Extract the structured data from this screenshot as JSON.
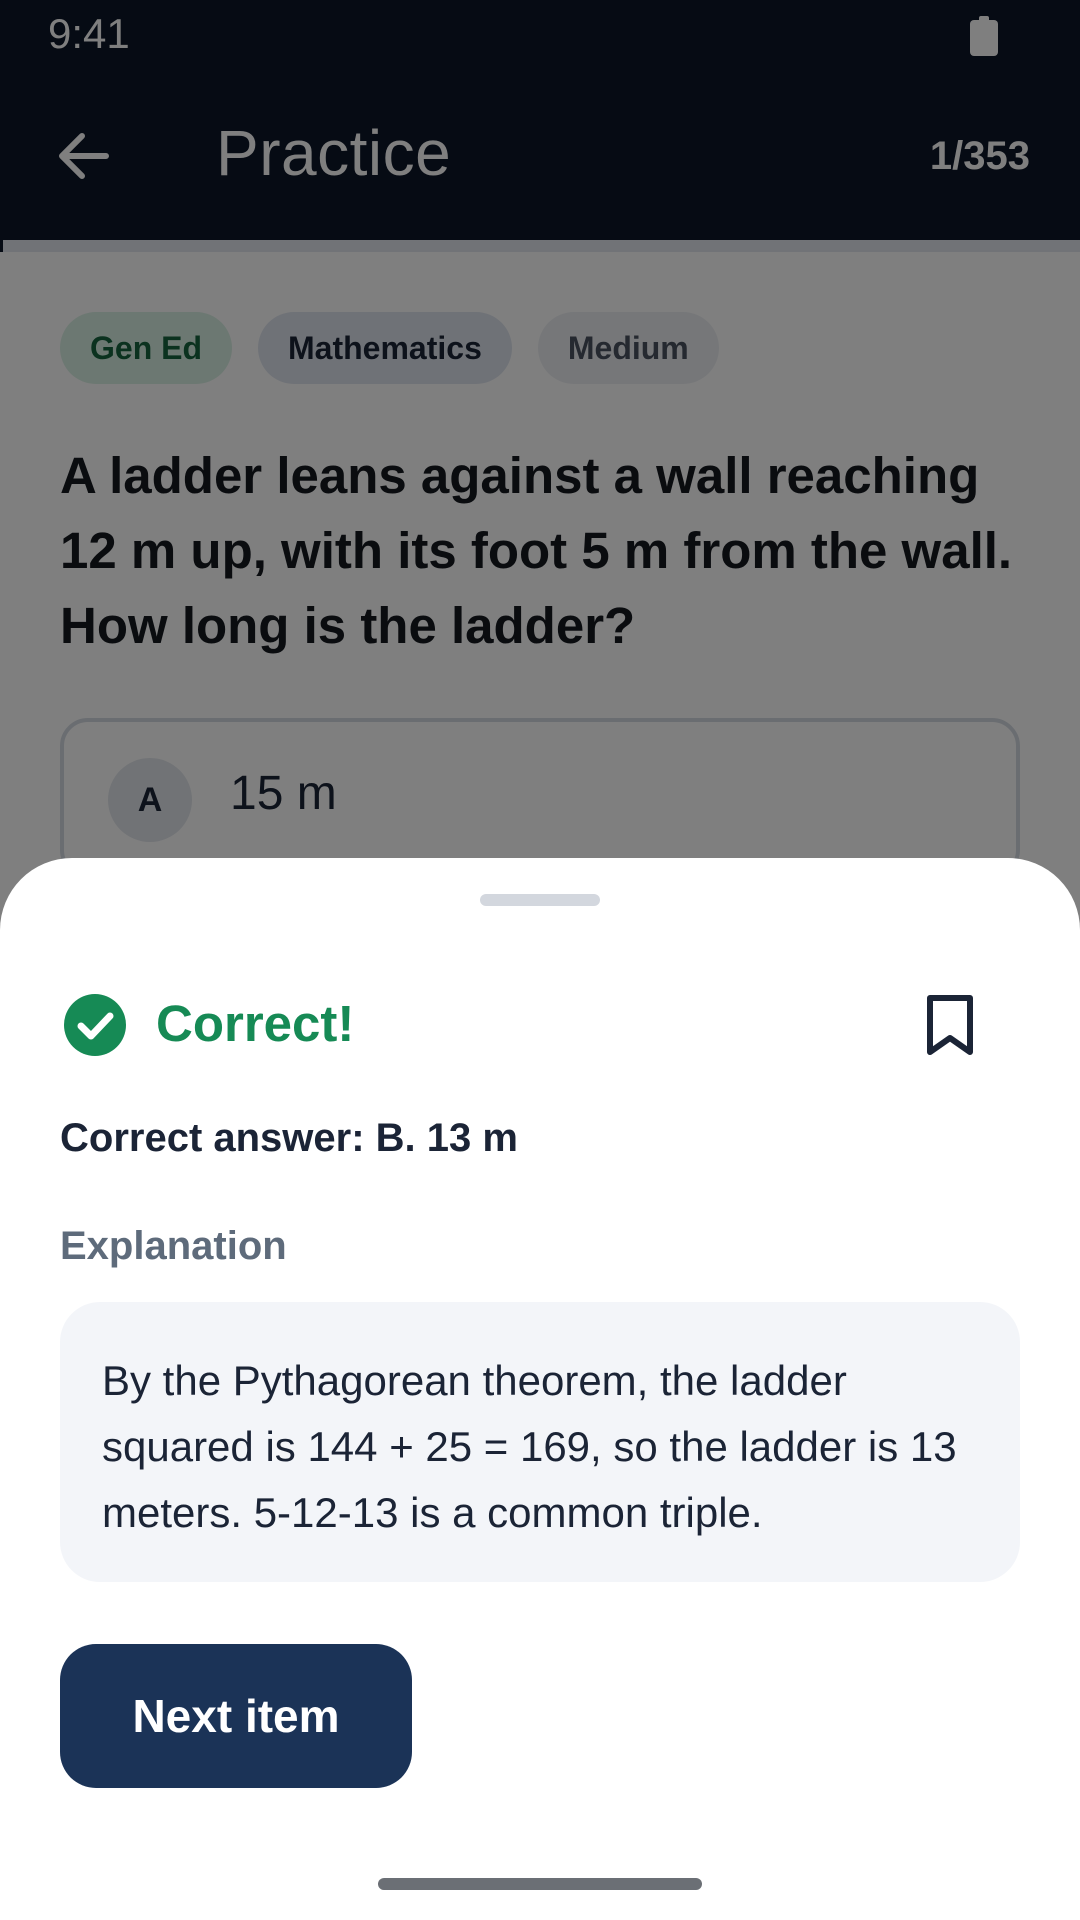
{
  "status_bar": {
    "time": "9:41",
    "battery_icon": "battery-icon"
  },
  "app_bar": {
    "back_icon": "arrow-left-icon",
    "title": "Practice",
    "counter": "1/353",
    "progress_fraction": 0.003
  },
  "question": {
    "tags": [
      {
        "label": "Gen Ed",
        "color": "#17643f"
      },
      {
        "label": "Mathematics",
        "color": "#1b2436"
      },
      {
        "label": "Medium",
        "color": "#4a5261"
      }
    ],
    "text": "A ladder leans against a wall reaching 12 m up, with its foot 5 m from the wall. How long is the ladder?",
    "options": [
      {
        "letter": "A",
        "text": "15 m"
      }
    ]
  },
  "feedback": {
    "status_icon": "check-circle-icon",
    "status_title": "Correct!",
    "status_color": "#168a55",
    "bookmark_icon": "bookmark-icon",
    "correct_answer": "Correct answer: B. 13 m",
    "explanation_label": "Explanation",
    "explanation_text": "By the Pythagorean theorem, the ladder squared is 144 + 25 = 169, so the ladder is 13 meters. 5-12-13 is a common triple.",
    "next_label": "Next item",
    "button_color": "#1b3357"
  }
}
